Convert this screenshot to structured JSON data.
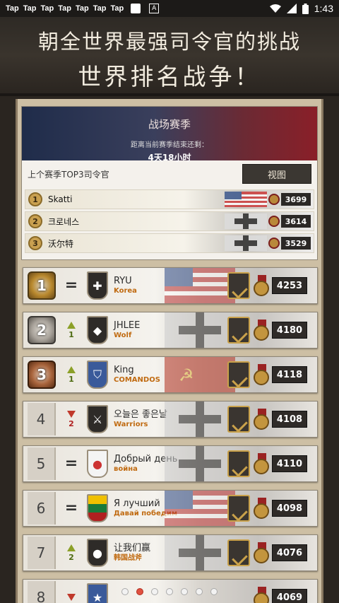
{
  "status_bar": {
    "tap_labels": [
      "Tap",
      "Tap",
      "Tap",
      "Tap",
      "Tap",
      "Tap",
      "Tap"
    ],
    "a_label": "A",
    "time": "1:43"
  },
  "header": {
    "line1": "朝全世界最强司令官的挑战",
    "line2": "世界排名战争！"
  },
  "season": {
    "title": "战场赛季",
    "subtitle": "距离当前赛季结束还剩：",
    "remaining": "4天18小时",
    "top3_title": "上个赛季TOP3司令官",
    "view_button": "视图",
    "top3": [
      {
        "rank": "1",
        "name": "Skatti",
        "score": "3699"
      },
      {
        "rank": "2",
        "name": "크로네스",
        "score": "3614"
      },
      {
        "rank": "3",
        "name": "沃尔特",
        "score": "3529"
      }
    ]
  },
  "ranks": [
    {
      "rank": "1",
      "change": "=",
      "change_num": "",
      "change_dir": "same",
      "emblem": "cross",
      "name": "RYU",
      "clan": "Korea",
      "score": "4253",
      "flag": "usa"
    },
    {
      "rank": "2",
      "change": "",
      "change_num": "1",
      "change_dir": "up",
      "emblem": "boar",
      "name": "JHLEE",
      "clan": "Wolf",
      "score": "4180",
      "flag": "germany"
    },
    {
      "rank": "3",
      "change": "",
      "change_num": "1",
      "change_dir": "up",
      "emblem": "shield",
      "name": "King",
      "clan": "COMANDOS",
      "score": "4118",
      "flag": "ussr"
    },
    {
      "rank": "4",
      "change": "",
      "change_num": "2",
      "change_dir": "down",
      "emblem": "swords",
      "name": "오늘은 좋은날",
      "clan": "Warriors",
      "score": "4108",
      "flag": "germany"
    },
    {
      "rank": "5",
      "change": "=",
      "change_num": "",
      "change_dir": "same",
      "emblem": "korea",
      "name": "Добрый день",
      "clan": "война",
      "score": "4110",
      "flag": "germany"
    },
    {
      "rank": "6",
      "change": "=",
      "change_num": "",
      "change_dir": "same",
      "emblem": "stripes",
      "name": "Я лучший",
      "clan": "Давай победим",
      "score": "4098",
      "flag": "usa"
    },
    {
      "rank": "7",
      "change": "",
      "change_num": "2",
      "change_dir": "up",
      "emblem": "grenade",
      "name": "让我们赢",
      "clan": "韩国战斧",
      "score": "4076",
      "flag": "germany"
    },
    {
      "rank": "8",
      "change": "",
      "change_num": "",
      "change_dir": "down",
      "emblem": "star",
      "name": "",
      "clan": "",
      "score": "4069",
      "flag": "usa"
    }
  ],
  "pager": {
    "count": 7,
    "active_index": 1
  }
}
